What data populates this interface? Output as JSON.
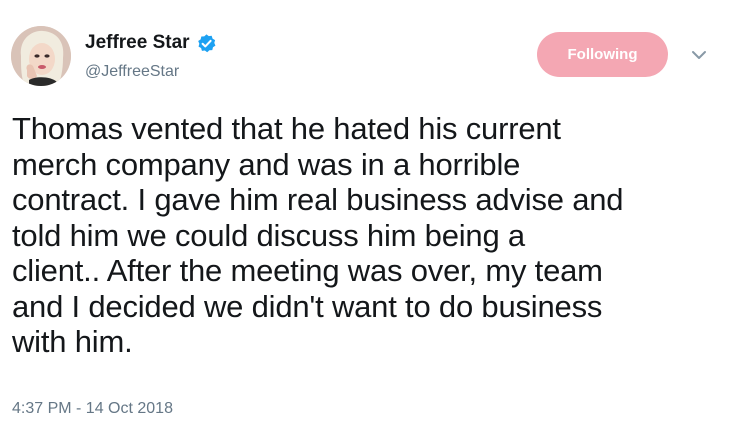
{
  "tweet": {
    "author": {
      "display_name": "Jeffree Star",
      "handle": "@JeffreeStar",
      "verified": true,
      "avatar_icon": "profile-avatar"
    },
    "follow_button_label": "Following",
    "menu_icon": "chevron-down-icon",
    "text_lines": [
      "Thomas vented that he hated his current",
      "merch company and was in a horrible",
      "contract. I gave him real business advise and",
      "told him we could discuss him being a",
      "client.. After the meeting was over, my team",
      "and I decided we didn't want to do business",
      "with him."
    ],
    "timestamp": "4:37 PM - 14 Oct 2018"
  },
  "colors": {
    "follow_button_bg": "#f4a7b3",
    "verified_blue": "#1da1f2",
    "secondary_text": "#657786",
    "primary_text": "#14171a"
  }
}
